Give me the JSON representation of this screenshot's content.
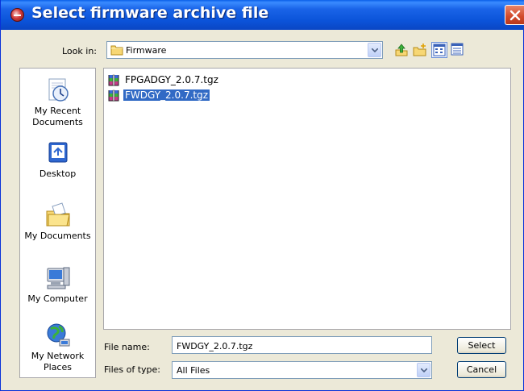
{
  "window": {
    "title": "Select firmware archive file"
  },
  "toolbar": {
    "look_in_label": "Look in:",
    "look_in_value": "Firmware"
  },
  "places": [
    {
      "label": "My Recent Documents",
      "lines": [
        "My Recent",
        "Documents"
      ],
      "icon": "recent-documents-icon"
    },
    {
      "label": "Desktop",
      "lines": [
        "Desktop"
      ],
      "icon": "desktop-icon"
    },
    {
      "label": "My Documents",
      "lines": [
        "My Documents"
      ],
      "icon": "my-documents-icon"
    },
    {
      "label": "My Computer",
      "lines": [
        "My Computer"
      ],
      "icon": "my-computer-icon"
    },
    {
      "label": "My Network Places",
      "lines": [
        "My Network",
        "Places"
      ],
      "icon": "network-places-icon"
    }
  ],
  "files": [
    {
      "name": "FPGADGY_2.0.7.tgz",
      "selected": false,
      "icon": "archive-file-icon"
    },
    {
      "name": "FWDGY_2.0.7.tgz",
      "selected": true,
      "icon": "archive-file-icon"
    }
  ],
  "form": {
    "file_name_label": "File name:",
    "file_name_value": "FWDGY_2.0.7.tgz",
    "file_type_label": "Files of type:",
    "file_type_value": "All Files"
  },
  "buttons": {
    "select_label": "Select",
    "cancel_label": "Cancel"
  },
  "colors": {
    "titlebar": "#0b53d9",
    "selection": "#316ac5",
    "dialog_bg": "#ece9d8"
  }
}
